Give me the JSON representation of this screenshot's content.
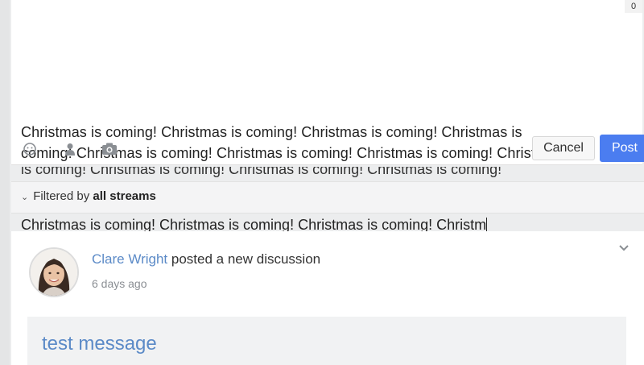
{
  "composer": {
    "char_count": "0",
    "text_lines": [
      "Christmas is coming!  Christmas is coming!  Christmas is coming!  Christmas is",
      "coming!  Christmas is coming!  Christmas is coming!  Christmas is coming!  Christmas is",
      "is coming!  Christmas is coming!  Christmas is coming!  Christmas is coming!"
    ],
    "cancel_label": "Cancel",
    "post_label": "Post",
    "icons": [
      "smiley-icon",
      "mention-person-icon",
      "camera-icon"
    ]
  },
  "filter": {
    "prefix": "Filtered by",
    "value": "all streams"
  },
  "echo_text": "Christmas is coming!  Christmas is coming!  Christmas is coming!  Christm",
  "feed": {
    "author": "Clare Wright",
    "action": "posted a new discussion",
    "time": "6 days ago",
    "message_title": "test message"
  },
  "colors": {
    "accent": "#4b7df0",
    "link": "#5b8ac7"
  }
}
